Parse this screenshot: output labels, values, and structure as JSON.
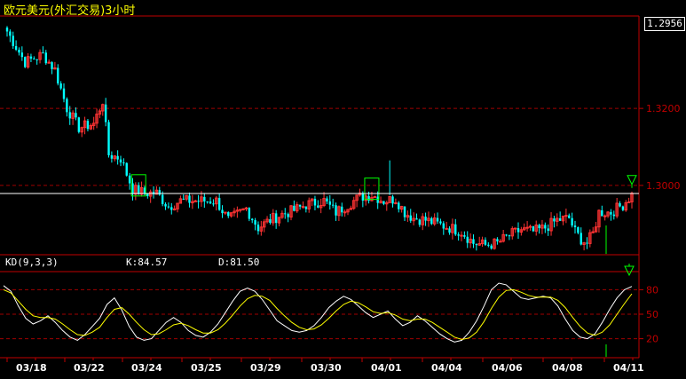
{
  "window": {
    "title": "欧元美元(外汇交易)3小时"
  },
  "current_price": "1.2956",
  "indicator": {
    "name": "KD(9,3,3)",
    "k_label": "K:84.57",
    "d_label": "D:81.50"
  },
  "colors": {
    "up": "#ff3333",
    "down": "#00ffff",
    "k_line": "#ffffff",
    "d_line": "#ffff00",
    "grid": "#a00000",
    "axis": "#c00000"
  },
  "chart_data": [
    {
      "type": "candlestick",
      "title": "欧元美元(外汇交易)3小时",
      "x_ticks": [
        "03/18",
        "03/22",
        "03/24",
        "03/25",
        "03/29",
        "03/30",
        "04/01",
        "04/04",
        "04/06",
        "04/08",
        "04/11"
      ],
      "y_ticks": [
        "1.3200",
        "1.3000"
      ],
      "ylim": [
        1.282,
        1.344
      ],
      "current_price": 1.2979,
      "grid": true,
      "anchors": [
        [
          0,
          1.34
        ],
        [
          6,
          1.332
        ],
        [
          12,
          1.334
        ],
        [
          16,
          1.33
        ],
        [
          20,
          1.32
        ],
        [
          24,
          1.315
        ],
        [
          29,
          1.316
        ],
        [
          32,
          1.322
        ],
        [
          34,
          1.308
        ],
        [
          38,
          1.307
        ],
        [
          42,
          1.299
        ],
        [
          46,
          1.298
        ],
        [
          50,
          1.298
        ],
        [
          54,
          1.2945
        ],
        [
          58,
          1.296
        ],
        [
          64,
          1.296
        ],
        [
          70,
          1.296
        ],
        [
          74,
          1.291
        ],
        [
          80,
          1.294
        ],
        [
          84,
          1.289
        ],
        [
          88,
          1.291
        ],
        [
          92,
          1.2925
        ],
        [
          96,
          1.2935
        ],
        [
          100,
          1.295
        ],
        [
          106,
          1.296
        ],
        [
          110,
          1.293
        ],
        [
          114,
          1.295
        ],
        [
          118,
          1.297
        ],
        [
          122,
          1.2975
        ],
        [
          126,
          1.296
        ],
        [
          130,
          1.2965
        ],
        [
          133,
          1.293
        ],
        [
          136,
          1.2915
        ],
        [
          140,
          1.291
        ],
        [
          144,
          1.29
        ],
        [
          148,
          1.289
        ],
        [
          152,
          1.288
        ],
        [
          156,
          1.285
        ],
        [
          160,
          1.2845
        ],
        [
          164,
          1.285
        ],
        [
          168,
          1.287
        ],
        [
          172,
          1.2885
        ],
        [
          176,
          1.288
        ],
        [
          180,
          1.289
        ],
        [
          184,
          1.291
        ],
        [
          188,
          1.2915
        ],
        [
          190,
          1.288
        ],
        [
          192,
          1.286
        ],
        [
          194,
          1.285
        ],
        [
          196,
          1.2875
        ],
        [
          198,
          1.293
        ],
        [
          202,
          1.293
        ],
        [
          206,
          1.295
        ],
        [
          209,
          1.2975
        ]
      ],
      "highlights": [
        44,
        122
      ],
      "signal_marks": [
        209
      ]
    },
    {
      "type": "line",
      "title": "KD(9,3,3)",
      "y_ticks": [
        "80",
        "50",
        "20"
      ],
      "ylim": [
        0,
        100
      ],
      "series": [
        {
          "name": "K",
          "values": [
            85,
            78,
            60,
            45,
            38,
            42,
            48,
            40,
            30,
            22,
            18,
            25,
            35,
            45,
            62,
            70,
            55,
            35,
            22,
            18,
            20,
            30,
            40,
            46,
            40,
            30,
            24,
            22,
            28,
            38,
            52,
            66,
            78,
            82,
            78,
            68,
            55,
            42,
            36,
            30,
            28,
            30,
            36,
            46,
            58,
            66,
            72,
            68,
            60,
            52,
            46,
            50,
            54,
            44,
            36,
            40,
            48,
            42,
            34,
            26,
            20,
            16,
            18,
            28,
            42,
            60,
            80,
            88,
            86,
            78,
            70,
            68,
            70,
            72,
            70,
            60,
            44,
            30,
            22,
            20,
            26,
            40,
            56,
            70,
            80,
            84
          ]
        },
        {
          "name": "D",
          "values": [
            80,
            76,
            66,
            56,
            48,
            46,
            46,
            44,
            38,
            31,
            25,
            24,
            28,
            34,
            46,
            56,
            58,
            50,
            40,
            31,
            25,
            26,
            31,
            37,
            39,
            36,
            31,
            27,
            27,
            31,
            39,
            49,
            60,
            69,
            73,
            72,
            67,
            57,
            48,
            40,
            34,
            31,
            32,
            37,
            45,
            54,
            62,
            66,
            64,
            59,
            53,
            51,
            52,
            49,
            44,
            42,
            44,
            44,
            40,
            34,
            28,
            22,
            19,
            21,
            28,
            41,
            57,
            71,
            79,
            80,
            77,
            73,
            71,
            71,
            71,
            67,
            58,
            46,
            35,
            27,
            24,
            28,
            37,
            50,
            63,
            75
          ]
        }
      ]
    }
  ]
}
